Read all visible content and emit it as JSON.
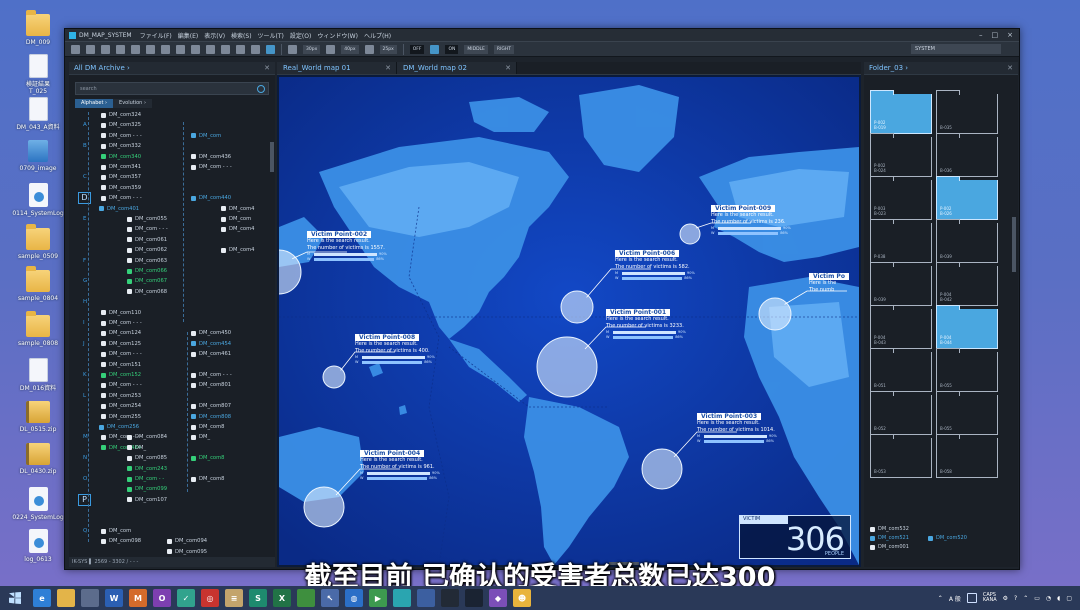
{
  "desktop": {
    "icons": [
      {
        "label": "DM_009",
        "kind": "folder"
      },
      {
        "label": "検証結果\nT_025",
        "kind": "file"
      },
      {
        "label": "DM_043_A資料",
        "kind": "file"
      },
      {
        "label": "0709_image",
        "kind": "image"
      },
      {
        "label": "0114_SystemLog",
        "kind": "exe"
      },
      {
        "label": "sample_0509",
        "kind": "folder"
      },
      {
        "label": "sample_0804",
        "kind": "folder"
      },
      {
        "label": "sample_0808",
        "kind": "folder"
      },
      {
        "label": "DM_016資料",
        "kind": "file"
      },
      {
        "label": "DL_0515.zip",
        "kind": "zip"
      },
      {
        "label": "DL_0430.zip",
        "kind": "zip"
      },
      {
        "label": "0224_SystemLog",
        "kind": "exe"
      },
      {
        "label": "log_0613",
        "kind": "exe"
      }
    ]
  },
  "app": {
    "title": "DM_MAP_SYSTEM",
    "menu": [
      "ファイル(F)",
      "編集(E)",
      "表示(V)",
      "検索(S)",
      "ツール(T)",
      "設定(O)",
      "ウィンドウ(W)",
      "ヘルプ(H)"
    ],
    "window_controls": [
      "–",
      "□",
      "×"
    ],
    "toolbar": {
      "fields": [
        "30px",
        "40px",
        "25px"
      ],
      "toggle_off": "OFF",
      "toggle_on": "ON",
      "mode1": "MIDDLE",
      "mode2": "RIGHT",
      "system_select": "SYSTEM"
    },
    "left_panel": {
      "tab_label": "All DM Archive",
      "search_placeholder": "search",
      "subtab_alphabet": "Alphabet",
      "subtab_evolution": "Evolution",
      "letters": [
        "A",
        "B",
        "C",
        "D",
        "E",
        "F",
        "G",
        "H",
        "I",
        "J",
        "K",
        "L",
        "M",
        "N",
        "O",
        "P",
        "Q"
      ],
      "col1": [
        {
          "t": "DM_com324",
          "c": "w"
        },
        {
          "t": "DM_com325",
          "c": "w"
        },
        {
          "t": "DM_com - - -",
          "c": "w"
        },
        {
          "t": "DM_com332",
          "c": "w"
        },
        {
          "t": "DM_com340",
          "c": "g"
        },
        {
          "t": "DM_com341",
          "c": "w"
        },
        {
          "t": "DM_com357",
          "c": "w"
        },
        {
          "t": "DM_com359",
          "c": "w"
        },
        {
          "t": "DM_com - - -",
          "c": "w"
        },
        {
          "t": "DM_com401",
          "c": "b"
        },
        {
          "t": "DM_com110",
          "c": "w"
        },
        {
          "t": "DM_com - - -",
          "c": "w"
        },
        {
          "t": "DM_com124",
          "c": "w"
        },
        {
          "t": "DM_com125",
          "c": "w"
        },
        {
          "t": "DM_com - - -",
          "c": "w"
        },
        {
          "t": "DM_com151",
          "c": "w"
        },
        {
          "t": "DM_com152",
          "c": "g"
        },
        {
          "t": "DM_com - - -",
          "c": "w"
        },
        {
          "t": "DM_com253",
          "c": "w"
        },
        {
          "t": "DM_com254",
          "c": "w"
        },
        {
          "t": "DM_com255",
          "c": "w"
        },
        {
          "t": "DM_com256",
          "c": "b"
        },
        {
          "t": "DM_com - - -",
          "c": "w"
        },
        {
          "t": "DM_com484",
          "c": "g"
        },
        {
          "t": "DM_com",
          "c": "w"
        },
        {
          "t": "DM_com098",
          "c": "w"
        }
      ],
      "col2": [
        {
          "t": "DM_com055",
          "c": "w"
        },
        {
          "t": "DM_com - - -",
          "c": "w"
        },
        {
          "t": "DM_com061",
          "c": "w"
        },
        {
          "t": "DM_com062",
          "c": "w"
        },
        {
          "t": "DM_com063",
          "c": "w"
        },
        {
          "t": "DM_com066",
          "c": "g"
        },
        {
          "t": "DM_com067",
          "c": "g"
        },
        {
          "t": "DM_com068",
          "c": "w"
        },
        {
          "t": "DM_com084",
          "c": "w"
        },
        {
          "t": "DM_",
          "c": "w"
        },
        {
          "t": "DM_com085",
          "c": "w"
        },
        {
          "t": "DM_com243",
          "c": "g"
        },
        {
          "t": "DM_com - -",
          "c": "g"
        },
        {
          "t": "DM_com099",
          "c": "g"
        },
        {
          "t": "DM_com107",
          "c": "w"
        },
        {
          "t": "DM_com094",
          "c": "w"
        },
        {
          "t": "DM_com095",
          "c": "w"
        }
      ],
      "col3": [
        {
          "t": "DM_com",
          "c": "b"
        },
        {
          "t": "DM_com436",
          "c": "w"
        },
        {
          "t": "DM_com - - -",
          "c": "w"
        },
        {
          "t": "DM_com440",
          "c": "b"
        },
        {
          "t": "DM_com4",
          "c": "w"
        },
        {
          "t": "DM_com",
          "c": "w"
        },
        {
          "t": "DM_com4",
          "c": "w"
        },
        {
          "t": "DM_com4",
          "c": "w"
        },
        {
          "t": "DM_com450",
          "c": "w"
        },
        {
          "t": "DM_com454",
          "c": "b"
        },
        {
          "t": "DM_com461",
          "c": "w"
        },
        {
          "t": "DM_com - - -",
          "c": "w"
        },
        {
          "t": "DM_com801",
          "c": "w"
        },
        {
          "t": "DM_com807",
          "c": "w"
        },
        {
          "t": "DM_com808",
          "c": "b"
        },
        {
          "t": "DM_com8",
          "c": "w"
        },
        {
          "t": "DM_",
          "c": "w"
        },
        {
          "t": "DM_com8",
          "c": "g"
        },
        {
          "t": "DM_com8",
          "c": "w"
        }
      ],
      "status": "IK-SYS ▌ 2569 - 3302 / - - -"
    },
    "map": {
      "tabs": [
        "Real_World map 01",
        "DM_World map 02"
      ],
      "victims": [
        {
          "title": "Victim Point-002",
          "l1": "Here is the search result.",
          "l2": "The number of victims is 1557.",
          "m": "90%",
          "w": "86%"
        },
        {
          "title": "Victim Point-006",
          "l1": "Here is the search result.",
          "l2": "The number of victims is    582.",
          "m": "90%",
          "w": "86%"
        },
        {
          "title": "Victim Point-009",
          "l1": "Here is the search result.",
          "l2": "The number of victims is    236.",
          "m": "90%",
          "w": "86%"
        },
        {
          "title": "Victim Po",
          "l1": "Here is the",
          "l2": "The numb",
          "m": "",
          "w": ""
        },
        {
          "title": "Victim Point-001",
          "l1": "Here is the search result.",
          "l2": "The number of victims is 3233.",
          "m": "90%",
          "w": "86%"
        },
        {
          "title": "Victim Point-008",
          "l1": "Here is the search result.",
          "l2": "The number of victims is    400.",
          "m": "90%",
          "w": "86%"
        },
        {
          "title": "Victim Point-003",
          "l1": "Here is the search result.",
          "l2": "The number of victims is 1014.",
          "m": "90%",
          "w": "86%"
        },
        {
          "title": "Victim Point-004",
          "l1": "Here is the search result.",
          "l2": "The number of victims is    961.",
          "m": "90%",
          "w": "86%"
        }
      ],
      "bar_label_m": "M",
      "bar_label_w": "W",
      "victim_head": "VICTIM",
      "victim_count": "306",
      "victim_unit": "PEOPLE"
    },
    "right_panel": {
      "tab_label": "Folder_03",
      "folders": [
        {
          "l": "P-002\nB-019",
          "sel": true
        },
        {
          "l": "B-035",
          "sel": false
        },
        {
          "l": "P-002\nB-024",
          "sel": false
        },
        {
          "l": "B-036",
          "sel": false
        },
        {
          "l": "P-003\nB-023",
          "sel": false
        },
        {
          "l": "P-002\nB-026",
          "sel": true
        },
        {
          "l": "P-038",
          "sel": false
        },
        {
          "l": "B-039",
          "sel": false
        },
        {
          "l": "B-039",
          "sel": false
        },
        {
          "l": "P-004\nB-042",
          "sel": false
        },
        {
          "l": "P-004\nB-043",
          "sel": false
        },
        {
          "l": "P-004\nB-044",
          "sel": true
        },
        {
          "l": "B-051",
          "sel": false
        },
        {
          "l": "B-055",
          "sel": false
        },
        {
          "l": "B-052",
          "sel": false
        },
        {
          "l": "B-055",
          "sel": false
        },
        {
          "l": "B-053",
          "sel": false
        },
        {
          "l": "B-058",
          "sel": false
        }
      ],
      "list": [
        {
          "t": "DM_com532",
          "c": "w"
        },
        {
          "t": "DM_com521",
          "c": "b"
        },
        {
          "t": "DM_com520",
          "c": "b"
        },
        {
          "t": "DM_com001",
          "c": "w"
        }
      ]
    }
  },
  "subtitle": "截至目前 已确认的受害者总数已达300",
  "taskbar": {
    "apps": [
      {
        "name": "ie-icon",
        "label": "e",
        "color": "#2e7fd6"
      },
      {
        "name": "explorer-icon",
        "label": "",
        "color": "#e3b449"
      },
      {
        "name": "tablet-icon",
        "label": "",
        "color": "#5c6c8c"
      },
      {
        "name": "word-icon",
        "label": "W",
        "color": "#2b5fb3"
      },
      {
        "name": "mail-icon",
        "label": "M",
        "color": "#d46b2b"
      },
      {
        "name": "onenote-icon",
        "label": "O",
        "color": "#7d3fb0"
      },
      {
        "name": "check-icon",
        "label": "✓",
        "color": "#31a38d"
      },
      {
        "name": "ring-icon",
        "label": "◎",
        "color": "#c8342f"
      },
      {
        "name": "books-icon",
        "label": "≡",
        "color": "#c3a46c"
      },
      {
        "name": "sway-icon",
        "label": "S",
        "color": "#1e8a6e"
      },
      {
        "name": "excel-icon",
        "label": "X",
        "color": "#217346"
      },
      {
        "name": "app-icon",
        "label": "",
        "color": "#3e8f3e"
      },
      {
        "name": "cursor-icon",
        "label": "↖",
        "color": "#4a6aa8"
      },
      {
        "name": "globe-icon",
        "label": "◍",
        "color": "#2b6fc7"
      },
      {
        "name": "play-icon",
        "label": "▶",
        "color": "#3d9a4f"
      },
      {
        "name": "tile-icon",
        "label": "",
        "color": "#2aa5b0"
      },
      {
        "name": "photo-icon",
        "label": "",
        "color": "#3c5fa0"
      },
      {
        "name": "terminal-icon",
        "label": "",
        "color": "#222a36"
      },
      {
        "name": "monitor-icon",
        "label": "",
        "color": "#1a2332"
      },
      {
        "name": "vs-icon",
        "label": "◆",
        "color": "#7b4fb8"
      },
      {
        "name": "character-icon",
        "label": "☻",
        "color": "#e9b43c"
      }
    ],
    "tray": {
      "ime": "A 般",
      "caps": "CAPS\nKANA",
      "time": "▢"
    }
  }
}
